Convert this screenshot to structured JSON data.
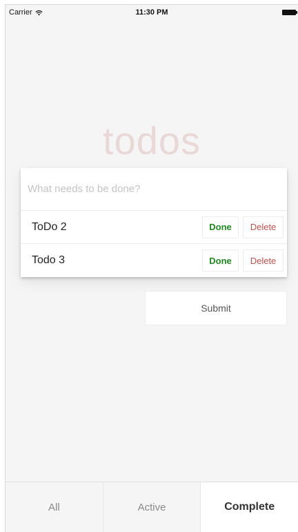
{
  "status_bar": {
    "carrier": "Carrier",
    "time": "11:30 PM",
    "wifi_icon": "wifi-icon",
    "battery_icon": "battery-icon"
  },
  "app": {
    "title": "todos",
    "title_color": "#af2f2f"
  },
  "new_todo": {
    "placeholder": "What needs to be done?",
    "value": ""
  },
  "todos": [
    {
      "label": "ToDo 2",
      "done_label": "Done",
      "delete_label": "Delete"
    },
    {
      "label": "Todo 3",
      "done_label": "Done",
      "delete_label": "Delete"
    }
  ],
  "submit": {
    "label": "Submit"
  },
  "tabs": {
    "items": [
      {
        "label": "All"
      },
      {
        "label": "Active"
      },
      {
        "label": "Complete"
      }
    ],
    "active": "Complete"
  },
  "colors": {
    "done": "#1f8a1f",
    "delete": "#c0504d",
    "background": "#f5f5f5"
  }
}
